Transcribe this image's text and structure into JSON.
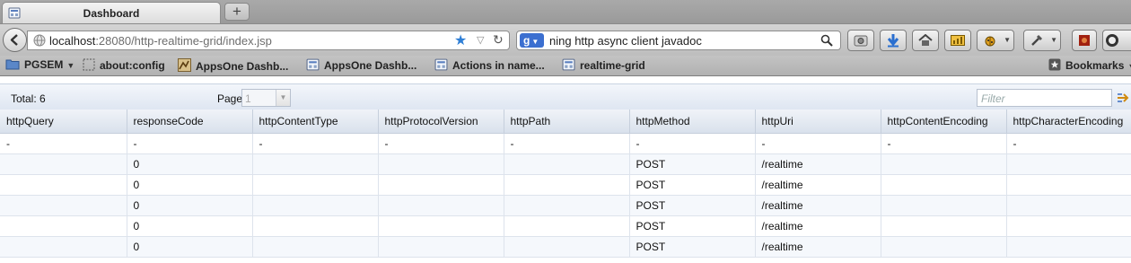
{
  "browser": {
    "tab_title": "Dashboard",
    "new_tab_label": "+",
    "url_host": "localhost",
    "url_rest": ":28080/http-realtime-grid/index.jsp",
    "search_query": "ning http async client javadoc",
    "search_engine_label": "g",
    "bookmarks": [
      {
        "label": "PGSEM",
        "icon": "folder-icon"
      },
      {
        "label": "about:config",
        "icon": "page-icon"
      },
      {
        "label": "AppsOne Dashb...",
        "icon": "bookmark-image-icon"
      },
      {
        "label": "AppsOne Dashb...",
        "icon": "app-favicon-icon"
      },
      {
        "label": "Actions in name...",
        "icon": "app-favicon-icon"
      },
      {
        "label": "realtime-grid",
        "icon": "app-favicon-icon"
      }
    ],
    "bookmarks_menu_label": "Bookmarks",
    "accent_color": "#2f7fd6"
  },
  "grid": {
    "total_label": "Total: 6",
    "page_label": "Page",
    "page_value": "1",
    "filter_placeholder": "Filter",
    "columns": [
      "httpQuery",
      "responseCode",
      "httpContentType",
      "httpProtocolVersion",
      "httpPath",
      "httpMethod",
      "httpUri",
      "httpContentEncoding",
      "httpCharacterEncoding"
    ],
    "rows": [
      [
        "-",
        "-",
        "-",
        "-",
        "-",
        "-",
        "-",
        "-",
        "-"
      ],
      [
        "",
        "0",
        "",
        "",
        "",
        "POST",
        "/realtime",
        "",
        ""
      ],
      [
        "",
        "0",
        "",
        "",
        "",
        "POST",
        "/realtime",
        "",
        ""
      ],
      [
        "",
        "0",
        "",
        "",
        "",
        "POST",
        "/realtime",
        "",
        ""
      ],
      [
        "",
        "0",
        "",
        "",
        "",
        "POST",
        "/realtime",
        "",
        ""
      ],
      [
        "",
        "0",
        "",
        "",
        "",
        "POST",
        "/realtime",
        "",
        ""
      ]
    ]
  }
}
